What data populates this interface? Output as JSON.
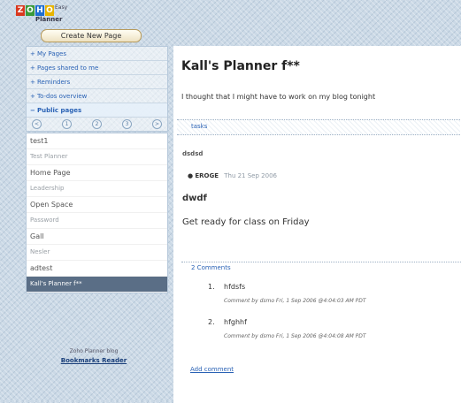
{
  "logo": {
    "letters": [
      "Z",
      "O",
      "H",
      "O"
    ],
    "sub_text": "Easy",
    "product": "Planner"
  },
  "toolbar": {
    "create_label": "Create New Page"
  },
  "sidebar": {
    "links": [
      {
        "label": "My Pages"
      },
      {
        "label": "Pages shared to me"
      },
      {
        "label": "Reminders"
      },
      {
        "label": "To-dos overview"
      },
      {
        "label": "Public pages"
      }
    ],
    "pager": [
      "<",
      "1",
      "2",
      "3",
      ">"
    ],
    "pages": [
      {
        "label": "test1",
        "style": "normal"
      },
      {
        "label": "Test Planner",
        "style": "dim"
      },
      {
        "label": "Home Page",
        "style": "normal"
      },
      {
        "label": "Leadership",
        "style": "dim"
      },
      {
        "label": "Open Space",
        "style": "normal"
      },
      {
        "label": "Password",
        "style": "dim"
      },
      {
        "label": "Gall",
        "style": "normal"
      },
      {
        "label": "Nesler",
        "style": "dim"
      },
      {
        "label": "adtest",
        "style": "normal"
      },
      {
        "label": "Kall's Planner f**",
        "style": "selected"
      }
    ],
    "powered_by": "Zoho Planner blog",
    "powered_link": "Bookmarks Reader"
  },
  "main": {
    "title": "Kall's Planner f**",
    "description": "I thought that I might have to work on my blog tonight",
    "tags_label": "tasks",
    "section_name": "dsdsd",
    "bullet": {
      "name": "EROGE",
      "stamp": "Thu 21 Sep 2006"
    },
    "heading1": "dwdf",
    "heading2": "Get ready for class on Friday",
    "comments_label": "2 Comments",
    "comments": [
      {
        "num": "1.",
        "text": "hfdsfs",
        "meta": "Comment by dsmo Fri, 1 Sep 2006 @4:04:03 AM PDT"
      },
      {
        "num": "2.",
        "text": "hfghhf",
        "meta": "Comment by dsmo Fri, 1 Sep 2006 @4:04:08 AM PDT"
      }
    ],
    "add_comment": "Add comment"
  }
}
